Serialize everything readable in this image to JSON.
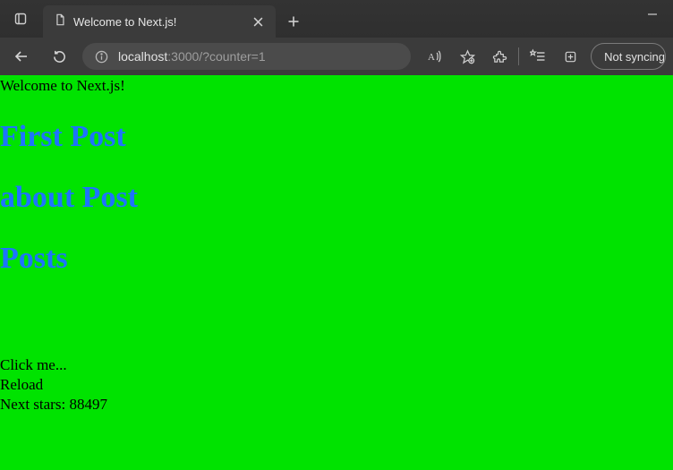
{
  "browser": {
    "tab_title": "Welcome to Next.js!",
    "address_host": "localhost",
    "address_port_path": ":3000/?counter=1",
    "sync_label": "Not syncing"
  },
  "page": {
    "welcome": "Welcome to Next.js!",
    "h1_first": "First Post",
    "h1_about": "about Post",
    "h1_posts": "Posts",
    "click_me": "Click me...",
    "reload": "Reload",
    "stars_label": "Next stars: ",
    "stars_value": "88497"
  }
}
